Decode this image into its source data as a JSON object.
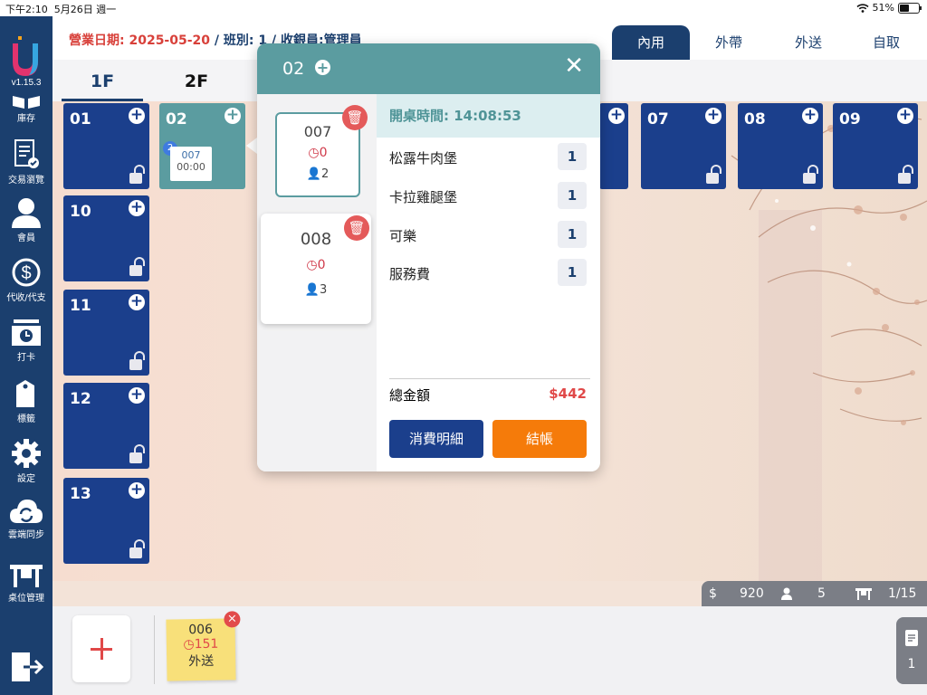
{
  "statusbar": {
    "time": "下午2:10",
    "date": "5月26日 週一",
    "battery": "51%",
    "battery_level": 0.51
  },
  "sidebar": {
    "version": "v1.15.3",
    "items": [
      {
        "label": "庫存",
        "icon": "inventory-icon"
      },
      {
        "label": "交易瀏覽",
        "icon": "transactions-icon"
      },
      {
        "label": "會員",
        "icon": "member-icon"
      },
      {
        "label": "代收/代支",
        "icon": "money-icon"
      },
      {
        "label": "打卡",
        "icon": "clock-in-icon"
      },
      {
        "label": "標籤",
        "icon": "tag-icon"
      },
      {
        "label": "設定",
        "icon": "gear-icon"
      },
      {
        "label": "雲端同步",
        "icon": "cloud-sync-icon"
      },
      {
        "label": "桌位管理",
        "icon": "table-icon"
      }
    ]
  },
  "header": {
    "biz_date_label": "營業日期: 2025-05-20",
    "shift_info": " / 班別: 1 / 收銀員:管理員",
    "order_tabs": [
      "內用",
      "外帶",
      "外送",
      "自取"
    ],
    "active_tab": "內用"
  },
  "floors": {
    "tabs": [
      "1F",
      "2F"
    ],
    "active": "1F"
  },
  "tables": [
    {
      "num": "01"
    },
    {
      "num": "02",
      "order": "007",
      "time": "00:00",
      "badge": "2"
    },
    {
      "num": "07"
    },
    {
      "num": "08"
    },
    {
      "num": "09"
    },
    {
      "num": "10"
    },
    {
      "num": "11"
    },
    {
      "num": "12"
    },
    {
      "num": "13"
    }
  ],
  "popup": {
    "table": "02",
    "open_time": "開桌時間: 14:08:53",
    "orders": [
      {
        "order": "007",
        "time": "0",
        "people": "2"
      },
      {
        "order": "008",
        "time": "0",
        "people": "3"
      }
    ],
    "items": [
      {
        "name": "松露牛肉堡",
        "qty": "1"
      },
      {
        "name": "卡拉雞腿堡",
        "qty": "1"
      },
      {
        "name": "可樂",
        "qty": "1"
      },
      {
        "name": "服務費",
        "qty": "1"
      }
    ],
    "total_label": "總金額",
    "total": "$442",
    "detail_button": "消費明細",
    "pay_button": "結帳"
  },
  "stats": {
    "amount": "920",
    "people": "5",
    "tables": "1/15"
  },
  "bottom": {
    "note": {
      "order": "006",
      "time": "151",
      "type": "外送"
    },
    "page": "1"
  }
}
